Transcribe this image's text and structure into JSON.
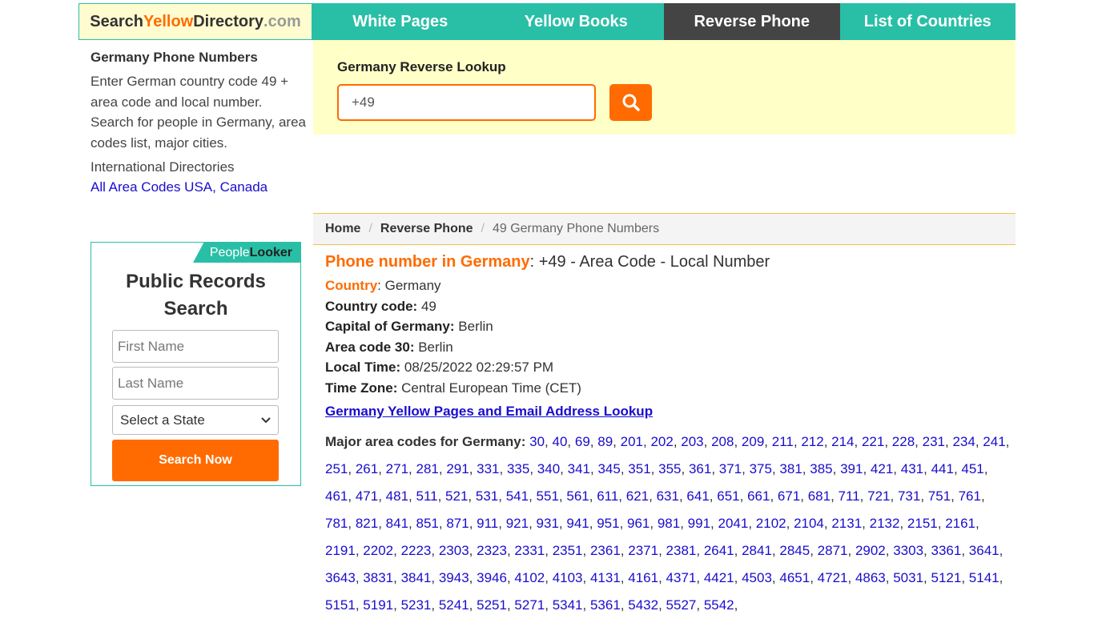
{
  "header": {
    "logo": {
      "part1": "Search",
      "part2": "Yellow",
      "part3": "Directory",
      "part4": ".com"
    },
    "nav": [
      {
        "label": "White Pages",
        "active": false
      },
      {
        "label": "Yellow Books",
        "active": false
      },
      {
        "label": "Reverse Phone",
        "active": true
      },
      {
        "label": "List of Countries",
        "active": false
      }
    ]
  },
  "sidebar": {
    "title": "Germany Phone Numbers",
    "description": "Enter German country code 49 + area code and local number. Search for people in Germany, area codes list, major cities.",
    "intl_label": "International Directories",
    "intl_link": "All Area Codes USA, Canada"
  },
  "people_looker": {
    "badge_part1": "People",
    "badge_part2": "Looker",
    "title": "Public Records Search",
    "first_name_placeholder": "First Name",
    "last_name_placeholder": "Last Name",
    "state_select": "Select a State",
    "button": "Search Now"
  },
  "lookup": {
    "label": "Germany Reverse Lookup",
    "value": "+49",
    "search_icon": "search-icon"
  },
  "breadcrumb": {
    "home": "Home",
    "reverse": "Reverse Phone",
    "current": "49 Germany Phone Numbers"
  },
  "main": {
    "heading_bold": "Phone number in Germany",
    "heading_rest": ": +49 - Area Code - Local Number",
    "country_label": "Country",
    "country_value": ": Germany",
    "code_label": "Country code:",
    "code_value": " 49",
    "capital_label": "Capital of Germany:",
    "capital_value": " Berlin",
    "area_label": "Area code 30:",
    "area_value": " Berlin",
    "time_label": "Local Time:",
    "time_value": " 08/25/2022 02:29:57 PM",
    "tz_label": "Time Zone:",
    "tz_value": " Central European Time (CET)",
    "yp_link": "Germany Yellow Pages and Email Address Lookup",
    "codes_label": "Major area codes for Germany:",
    "area_codes": [
      "30",
      "40",
      "69",
      "89",
      "201",
      "202",
      "203",
      "208",
      "209",
      "211",
      "212",
      "214",
      "221",
      "228",
      "231",
      "234",
      "241",
      "251",
      "261",
      "271",
      "281",
      "291",
      "331",
      "335",
      "340",
      "341",
      "345",
      "351",
      "355",
      "361",
      "371",
      "375",
      "381",
      "385",
      "391",
      "421",
      "431",
      "441",
      "451",
      "461",
      "471",
      "481",
      "511",
      "521",
      "531",
      "541",
      "551",
      "561",
      "611",
      "621",
      "631",
      "641",
      "651",
      "661",
      "671",
      "681",
      "711",
      "721",
      "731",
      "751",
      "761",
      "781",
      "821",
      "841",
      "851",
      "871",
      "911",
      "921",
      "931",
      "941",
      "951",
      "961",
      "981",
      "991",
      "2041",
      "2102",
      "2104",
      "2131",
      "2132",
      "2151",
      "2161",
      "2191",
      "2202",
      "2223",
      "2303",
      "2323",
      "2331",
      "2351",
      "2361",
      "2371",
      "2381",
      "2641",
      "2841",
      "2845",
      "2871",
      "2902",
      "3303",
      "3361",
      "3641",
      "3643",
      "3831",
      "3841",
      "3943",
      "3946",
      "4102",
      "4103",
      "4131",
      "4161",
      "4371",
      "4421",
      "4503",
      "4651",
      "4721",
      "4863",
      "5031",
      "5121",
      "5141",
      "5151",
      "5191",
      "5231",
      "5241",
      "5251",
      "5271",
      "5341",
      "5361",
      "5432",
      "5527",
      "5542"
    ]
  },
  "colors": {
    "accent": "#29bfa6",
    "orange": "#ff6b00",
    "panel": "#ffffc8",
    "link": "#1a0dcc"
  }
}
